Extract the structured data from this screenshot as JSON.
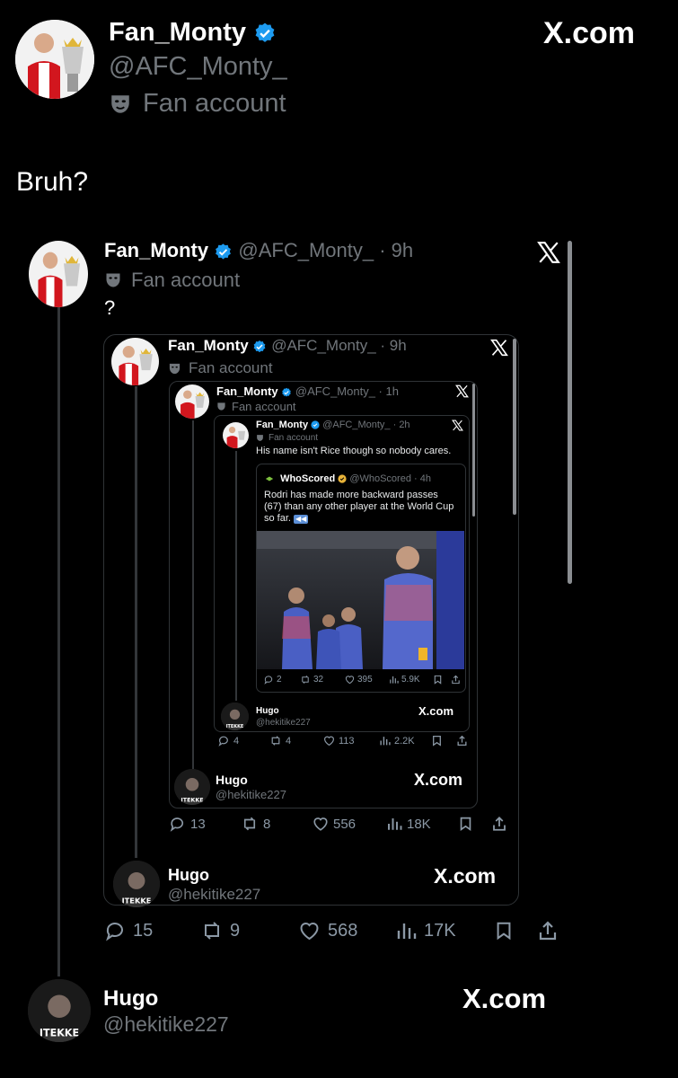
{
  "main": {
    "name": "Fan_Monty",
    "handle": "@AFC_Monty_",
    "badge": "Fan account",
    "brand": "X.com",
    "text": "Bruh?"
  },
  "l1": {
    "name": "Fan_Monty",
    "meta": "@AFC_Monty_ · 9h",
    "badge": "Fan account",
    "text": "?",
    "stats": {
      "reply": "15",
      "retweet": "9",
      "like": "568",
      "views": "17K"
    }
  },
  "l2": {
    "name": "Fan_Monty",
    "meta": "@AFC_Monty_ · 9h",
    "badge": "Fan account",
    "footer": {
      "name": "Hugo",
      "handle": "@hekitike227",
      "brand": "X.com"
    }
  },
  "l3": {
    "name": "Fan_Monty",
    "meta": "@AFC_Monty_ · 1h",
    "badge": "Fan account",
    "stats": {
      "reply": "13",
      "retweet": "8",
      "like": "556",
      "views": "18K"
    },
    "footer": {
      "name": "Hugo",
      "handle": "@hekitike227",
      "brand": "X.com"
    }
  },
  "l4": {
    "name": "Fan_Monty",
    "meta": "@AFC_Monty_ · 2h",
    "badge": "Fan account",
    "text": "His name isn't Rice though so nobody cares.",
    "stats": {
      "reply": "4",
      "retweet": "4",
      "like": "113",
      "views": "2.2K"
    },
    "footer": {
      "name": "Hugo",
      "handle": "@hekitike227",
      "brand": "X.com"
    }
  },
  "l5": {
    "name": "WhoScored",
    "meta": "@WhoScored · 4h",
    "text": "Rodri has made more backward passes (67) than any other player at the World Cup so far.",
    "stats": {
      "reply": "2",
      "retweet": "32",
      "like": "395",
      "views": "5.9K"
    }
  },
  "bottom": {
    "name": "Hugo",
    "handle": "@hekitike227",
    "brand": "X.com"
  },
  "colors": {
    "verified": "#1d9bf0",
    "bg": "#000000",
    "muted": "#71767b",
    "gold_badge": "#e8b339"
  }
}
